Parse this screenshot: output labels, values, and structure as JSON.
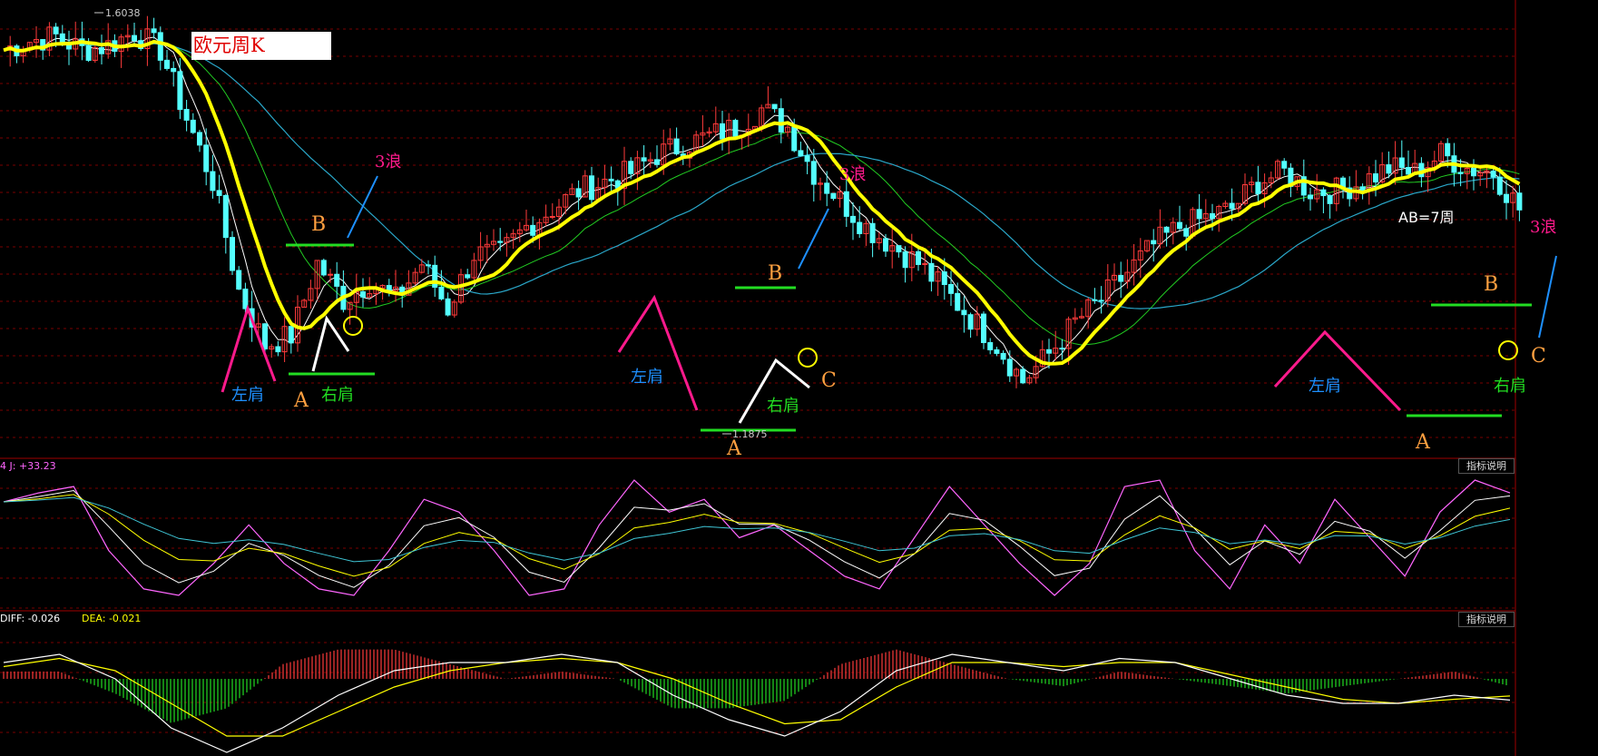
{
  "title": "欧元周K",
  "max_label": "1.6038",
  "min_label": "1.1875",
  "kdj_readout": "4  J: +33.23",
  "macd_readout_diff": "DIFF: -0.026",
  "macd_readout_dea": "DEA: -0.021",
  "indicator_button": "指标说明",
  "annotations": {
    "left_shoulder": "左肩",
    "right_shoulder": "右肩",
    "wave3": "3浪",
    "A": "A",
    "B": "B",
    "C": "C",
    "ab_weeks": "AB=7周"
  },
  "colors": {
    "background": "#000000",
    "up_candle": "#ff3b3b",
    "down_candle": "#54ffff",
    "ma_thick": "#ffff00",
    "ma_white": "#ffffff",
    "ma_green": "#22cc22",
    "ma_cyan": "#2aa7c9",
    "magenta": "#ff1a8c",
    "orange": "#ffa040",
    "green_line": "#22dd22",
    "blue_annot": "#1e90ff",
    "kdj_k": "#ffffff",
    "kdj_d": "#ffff00",
    "kdj_j": "#ff66ff",
    "macd_pos": "#ff3b3b",
    "macd_neg": "#22dd22",
    "macd_diff": "#ffffff",
    "macd_dea": "#ffff00"
  },
  "chart_data": [
    {
      "type": "candlestick",
      "title": "欧元周K",
      "ylim": [
        1.15,
        1.62
      ],
      "grid": true,
      "x": [
        0,
        4,
        8,
        12,
        16,
        20,
        24,
        28,
        32,
        36,
        40,
        44,
        48,
        52,
        56,
        60,
        64,
        68,
        72,
        76,
        80,
        84,
        88,
        92,
        96,
        100,
        104,
        108,
        112,
        116,
        120,
        124,
        128,
        132,
        136,
        140,
        144,
        148,
        152,
        156,
        160,
        164,
        168,
        172,
        176,
        180,
        184,
        188,
        192,
        196,
        200,
        204,
        208,
        212,
        216,
        220,
        224,
        228,
        232
      ],
      "close": [
        1.575,
        1.585,
        1.59,
        1.575,
        1.58,
        1.595,
        1.575,
        1.5,
        1.43,
        1.31,
        1.25,
        1.26,
        1.34,
        1.3,
        1.32,
        1.3,
        1.34,
        1.29,
        1.35,
        1.35,
        1.38,
        1.4,
        1.42,
        1.43,
        1.44,
        1.46,
        1.47,
        1.48,
        1.49,
        1.51,
        1.49,
        1.44,
        1.41,
        1.38,
        1.36,
        1.34,
        1.31,
        1.28,
        1.25,
        1.21,
        1.24,
        1.275,
        1.3,
        1.33,
        1.36,
        1.38,
        1.39,
        1.4,
        1.43,
        1.44,
        1.42,
        1.42,
        1.43,
        1.445,
        1.44,
        1.46,
        1.445,
        1.44,
        1.4
      ]
    },
    {
      "type": "line",
      "title": "KDJ",
      "series": [
        {
          "name": "J",
          "values": [
            0.78,
            0.85,
            0.9,
            0.4,
            0.1,
            0.05,
            0.3,
            0.6,
            0.3,
            0.1,
            0.05,
            0.4,
            0.8,
            0.7,
            0.4,
            0.05,
            0.1,
            0.6,
            0.95,
            0.7,
            0.8,
            0.5,
            0.6,
            0.4,
            0.2,
            0.1,
            0.5,
            0.9,
            0.6,
            0.3,
            0.05,
            0.3,
            0.9,
            0.95,
            0.4,
            0.1,
            0.6,
            0.3,
            0.8,
            0.5,
            0.2,
            0.7,
            0.95,
            0.85
          ]
        }
      ]
    },
    {
      "type": "bar+line",
      "title": "MACD",
      "series": [
        {
          "name": "DIFF",
          "values": [
            0.02,
            0.03,
            0.0,
            -0.06,
            -0.09,
            -0.06,
            -0.02,
            0.01,
            0.02,
            0.02,
            0.03,
            0.02,
            -0.02,
            -0.05,
            -0.07,
            -0.04,
            0.01,
            0.03,
            0.02,
            0.01,
            0.025,
            0.02,
            0.0,
            -0.02,
            -0.03,
            -0.03,
            -0.02,
            -0.026
          ]
        },
        {
          "name": "DEA",
          "values": [
            0.015,
            0.025,
            0.01,
            -0.03,
            -0.07,
            -0.07,
            -0.04,
            -0.01,
            0.01,
            0.02,
            0.025,
            0.02,
            0.0,
            -0.03,
            -0.055,
            -0.05,
            -0.01,
            0.02,
            0.02,
            0.015,
            0.02,
            0.02,
            0.005,
            -0.01,
            -0.025,
            -0.03,
            -0.025,
            -0.021
          ]
        }
      ]
    }
  ]
}
